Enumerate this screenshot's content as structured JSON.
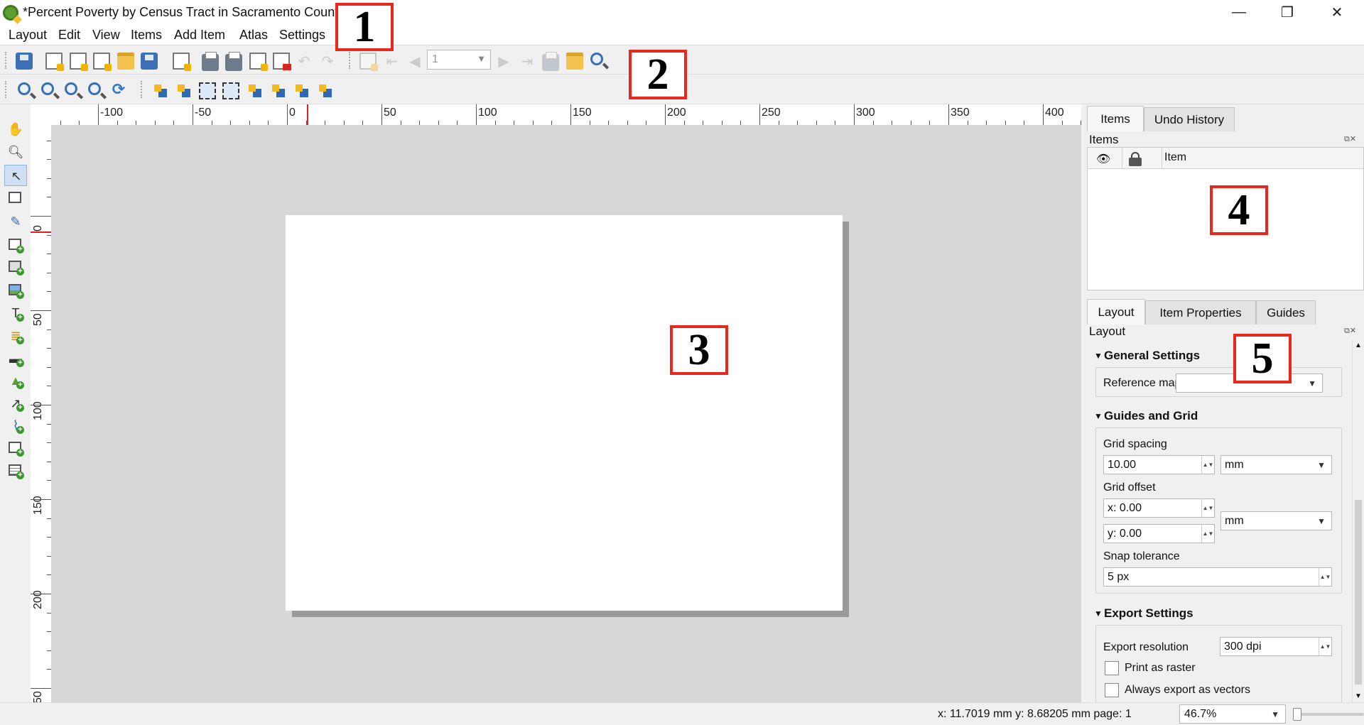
{
  "window": {
    "title": "*Percent Poverty by Census Tract in Sacramento County.",
    "minimize": "—",
    "restore": "❐",
    "close": "✕"
  },
  "menu": [
    "Layout",
    "Edit",
    "View",
    "Items",
    "Add Item",
    "Atlas",
    "Settings"
  ],
  "annotations": [
    "1",
    "2",
    "3",
    "4",
    "5"
  ],
  "atlas_toolbar": {
    "page_value": "1"
  },
  "ruler": {
    "h_labels": [
      "-100",
      "-50",
      "0",
      "50",
      "100",
      "150",
      "200",
      "250",
      "300",
      "350",
      "400"
    ],
    "v_labels": [
      "0",
      "50",
      "100",
      "150",
      "200",
      "50"
    ]
  },
  "dock": {
    "top_tabs": [
      "Items",
      "Undo History"
    ],
    "items_panel_title": "Items",
    "items_header_item": "Item",
    "bottom_tabs": [
      "Layout",
      "Item Properties",
      "Guides"
    ],
    "layout_panel_title": "Layout"
  },
  "layout_props": {
    "general_title": "General Settings",
    "reference_map_label": "Reference map",
    "reference_map_value": "",
    "guides_title": "Guides and Grid",
    "grid_spacing_label": "Grid spacing",
    "grid_spacing_value": "10.00",
    "grid_spacing_unit": "mm",
    "grid_offset_label": "Grid offset",
    "grid_offset_x": "x: 0.00",
    "grid_offset_y": "y: 0.00",
    "grid_offset_unit": "mm",
    "snap_label": "Snap tolerance",
    "snap_value": "5 px",
    "export_title": "Export Settings",
    "export_res_label": "Export resolution",
    "export_res_value": "300 dpi",
    "print_raster_label": "Print as raster",
    "always_vectors_label": "Always export as vectors"
  },
  "status": {
    "coords": "x: 11.7019 mm y: 8.68205 mm page: 1",
    "zoom": "46.7%"
  }
}
